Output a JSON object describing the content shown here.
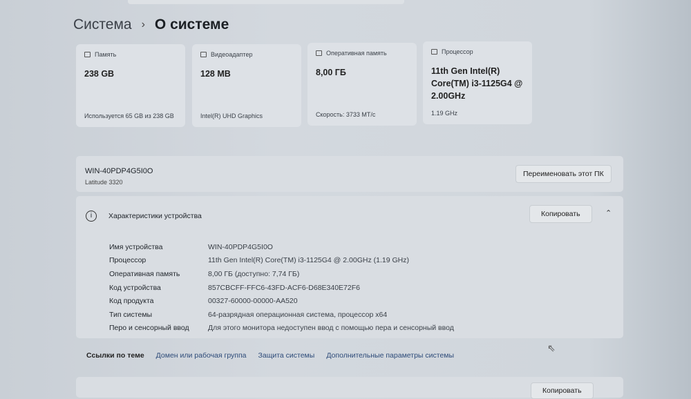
{
  "breadcrumb": {
    "parent": "Система",
    "current": "О системе"
  },
  "cards": [
    {
      "title": "Память",
      "value": "238 GB",
      "sub": "Используется 65 GB из 238 GB"
    },
    {
      "title": "Видеоадаптер",
      "value": "128 MB",
      "sub": "Intel(R) UHD Graphics"
    },
    {
      "title": "Оперативная память",
      "value": "8,00 ГБ",
      "sub": "Скорость: 3733 МТ/с"
    },
    {
      "title": "Процессор",
      "value": "11th Gen Intel(R) Core(TM) i3-1125G4 @ 2.00GHz",
      "sub": "1.19 GHz"
    }
  ],
  "pc": {
    "name": "WIN-40PDP4G5I0O",
    "model": "Latitude 3320",
    "rename": "Переименовать этот ПК"
  },
  "specs": {
    "title": "Характеристики устройства",
    "copy": "Копировать",
    "rows": [
      {
        "k": "Имя устройства",
        "v": "WIN-40PDP4G5I0O"
      },
      {
        "k": "Процессор",
        "v": "11th Gen Intel(R) Core(TM) i3-1125G4 @ 2.00GHz (1.19 GHz)"
      },
      {
        "k": "Оперативная память",
        "v": "8,00 ГБ (доступно: 7,74 ГБ)"
      },
      {
        "k": "Код устройства",
        "v": "857CBCFF-FFC6-43FD-ACF6-D68E340E72F6"
      },
      {
        "k": "Код продукта",
        "v": "00327-60000-00000-AA520"
      },
      {
        "k": "Тип системы",
        "v": "64-разрядная операционная система, процессор x64"
      },
      {
        "k": "Перо и сенсорный ввод",
        "v": "Для этого монитора недоступен ввод с помощью пера и сенсорный ввод"
      }
    ]
  },
  "links": {
    "title": "Ссылки по теме",
    "items": [
      "Домен или рабочая группа",
      "Защита системы",
      "Дополнительные параметры системы"
    ]
  },
  "bottom": {
    "copy": "Копировать"
  }
}
